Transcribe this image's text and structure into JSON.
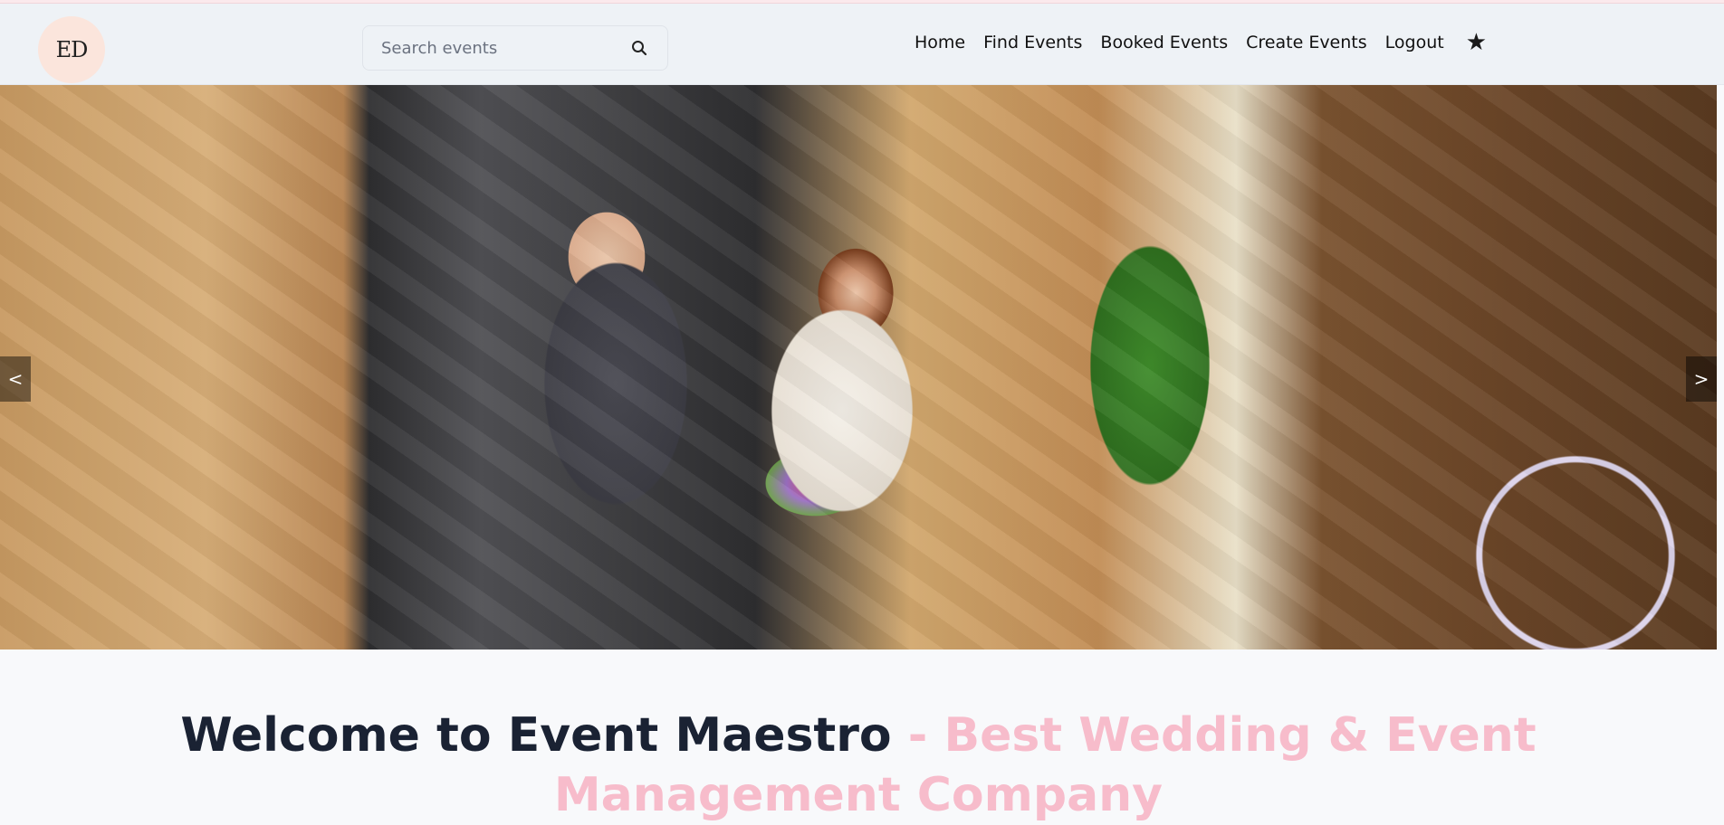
{
  "header": {
    "logo_text": "ED",
    "search": {
      "placeholder": "Search events"
    },
    "nav": [
      {
        "label": "Home"
      },
      {
        "label": "Find Events"
      },
      {
        "label": "Booked Events"
      },
      {
        "label": "Create Events"
      },
      {
        "label": "Logout"
      }
    ],
    "favorite_icon": "star-icon"
  },
  "hero": {
    "prev_label": "<",
    "next_label": ">",
    "image": "wedding couple with bouquet"
  },
  "welcome": {
    "main": "Welcome to Event Maestro ",
    "accent": "- Best Wedding & Event Management Company"
  },
  "colors": {
    "header_bg": "#eef2f6",
    "accent_pink": "#f7bccb",
    "text_dark": "#1a2233"
  }
}
